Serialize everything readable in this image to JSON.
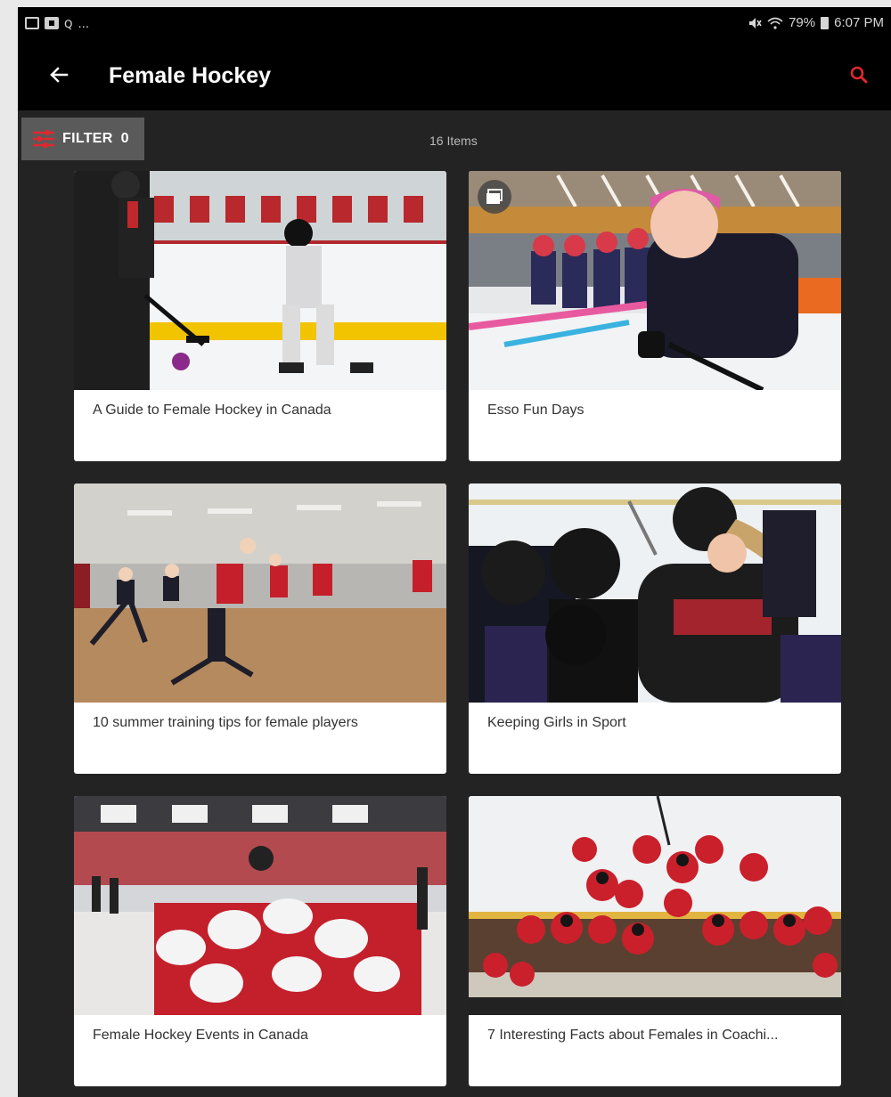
{
  "status_bar": {
    "left_glyph": "ꞯ",
    "overflow": "...",
    "battery": "79%",
    "time": "6:07 PM"
  },
  "appbar": {
    "title": "Female Hockey"
  },
  "filter": {
    "label": "FILTER",
    "count": "0"
  },
  "items_count": "16 Items",
  "cards": [
    {
      "title": "A Guide to Female Hockey in Canada"
    },
    {
      "title": "Esso Fun Days"
    },
    {
      "title": "10 summer training tips for female players"
    },
    {
      "title": "Keeping Girls in Sport"
    },
    {
      "title": "Female Hockey Events in Canada"
    },
    {
      "title": "7 Interesting Facts about Females in Coachi..."
    }
  ],
  "colors": {
    "accent": "#d8181e",
    "appbar": "#000000",
    "background": "#232323"
  }
}
